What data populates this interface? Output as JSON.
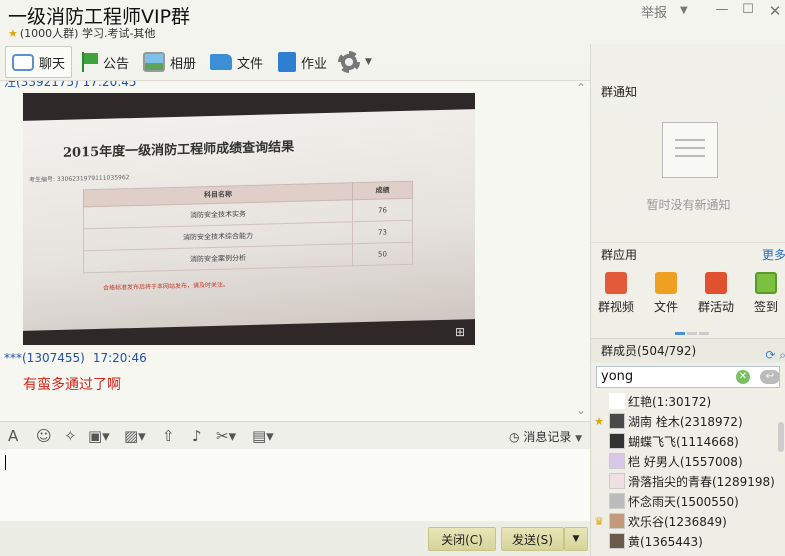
{
  "window": {
    "title": "一级消防工程师VIP群",
    "subtitle": "(1000人群) 学习.考试-其他",
    "report": "举报",
    "min": "—",
    "max": "☐",
    "close": "✕"
  },
  "toolbar": {
    "chat": "聊天",
    "notice": "公告",
    "album": "相册",
    "file": "文件",
    "homework": "作业"
  },
  "chat": {
    "prev_sender": "汪(3392175)  17:20:45",
    "screen_title": "2015年度一级消防工程师成绩查询结果",
    "screen_id": "考生编号: 3306231979111035962",
    "table_header": [
      "科目名称",
      "成绩"
    ],
    "table_rows": [
      [
        "消防安全技术实务",
        "76"
      ],
      [
        "消防安全技术综合能力",
        "73"
      ],
      [
        "消防安全案例分析",
        "50"
      ]
    ],
    "screen_note": "合格标准发布后将于本网站发布，请及时关注。",
    "sender": "***(1307455)",
    "time": "17:20:46",
    "message": "有蛮多通过了啊"
  },
  "input": {
    "history": "消息记录",
    "close_btn": "关闭(C)",
    "send_btn": "发送(S)"
  },
  "right": {
    "notice_title": "群通知",
    "notice_empty": "暂时没有新通知",
    "apps_title": "群应用",
    "more": "更多",
    "apps": [
      "群视频",
      "文件",
      "群活动",
      "签到"
    ],
    "members_title": "群成员(504/792)",
    "search_value": "yong",
    "members": [
      {
        "name": "红艳(1:30172)",
        "badge": ""
      },
      {
        "name": "湖南  栓木(2318972)",
        "badge": "★"
      },
      {
        "name": "蝴蝶飞飞(1114668)",
        "badge": ""
      },
      {
        "name": "桤 好男人(1557008)",
        "badge": ""
      },
      {
        "name": "滑落指尖的青春(1289198)",
        "badge": ""
      },
      {
        "name": "怀念雨天(1500550)",
        "badge": ""
      },
      {
        "name": "欢乐谷(1236849)",
        "badge": "♛"
      },
      {
        "name": "黄(1365443)",
        "badge": ""
      }
    ]
  }
}
